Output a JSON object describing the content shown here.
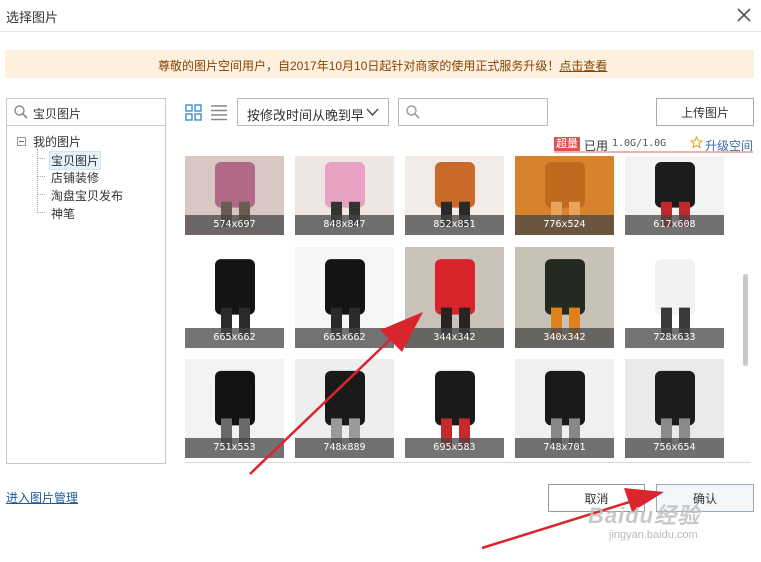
{
  "dialog": {
    "title": "选择图片"
  },
  "notice": {
    "text": "尊敬的图片空间用户，自2017年10月10日起针对商家的使用正式服务升级！",
    "link": "点击查看"
  },
  "tree": {
    "search_value": "宝贝图片",
    "root": "我的图片",
    "children": [
      "宝贝图片",
      "店铺装修",
      "淘盘宝贝发布",
      "神笔"
    ],
    "selected": "宝贝图片"
  },
  "toolbar": {
    "sort_value": "按修改时间从晚到早",
    "upload_label": "上传图片"
  },
  "quota": {
    "badge": "超量",
    "used_label": "已用",
    "used_value": "1.0G/1.0G",
    "upgrade_label": "升级空间"
  },
  "images": [
    {
      "size": "574x697",
      "colors": [
        "#d9c7c4",
        "#b06a88",
        "#6a5a50"
      ]
    },
    {
      "size": "848x847",
      "colors": [
        "#efe6e4",
        "#e7a2c3",
        "#333"
      ]
    },
    {
      "size": "852x851",
      "colors": [
        "#f2ece8",
        "#c9692a",
        "#2a2a2a"
      ]
    },
    {
      "size": "776x524",
      "colors": [
        "#d8822e",
        "#c06a20",
        "#e9a45a"
      ]
    },
    {
      "size": "617x608",
      "colors": [
        "#f3f3f3",
        "#1c1c1c",
        "#c0282e"
      ]
    },
    {
      "size": "665x662",
      "colors": [
        "#ffffff",
        "#141414",
        "#2a2a2a"
      ]
    },
    {
      "size": "665x662",
      "colors": [
        "#f6f6f6",
        "#141414",
        "#2a2a2a"
      ]
    },
    {
      "size": "344x342",
      "colors": [
        "#c9c2b8",
        "#d8232a",
        "#2a2320"
      ]
    },
    {
      "size": "340x342",
      "colors": [
        "#c6c2b6",
        "#232a22",
        "#e0801c"
      ]
    },
    {
      "size": "728x633",
      "colors": [
        "#ffffff",
        "#f2f2f2",
        "#3a3a3a"
      ]
    },
    {
      "size": "751x553",
      "colors": [
        "#f3f3f3",
        "#121212",
        "#6a6a6a"
      ]
    },
    {
      "size": "748x889",
      "colors": [
        "#eeeeee",
        "#1a1a1a",
        "#9a9a9a"
      ]
    },
    {
      "size": "695x583",
      "colors": [
        "#ffffff",
        "#1a1a1a",
        "#c62a2a"
      ]
    },
    {
      "size": "748x701",
      "colors": [
        "#f0f0f0",
        "#1a1a1a",
        "#888888"
      ]
    },
    {
      "size": "756x654",
      "colors": [
        "#eaeaea",
        "#1c1c1c",
        "#8a8a8a"
      ]
    }
  ],
  "footer": {
    "manage_link": "进入图片管理",
    "cancel_label": "取消",
    "ok_label": "确认"
  },
  "watermark": {
    "brand": "Baidu经验",
    "url": "jingyan.baidu.com"
  },
  "colors": {
    "annotation_arrow": "#d9262e",
    "notice_bg": "#fdf0de",
    "link": "#1a5a9a"
  }
}
